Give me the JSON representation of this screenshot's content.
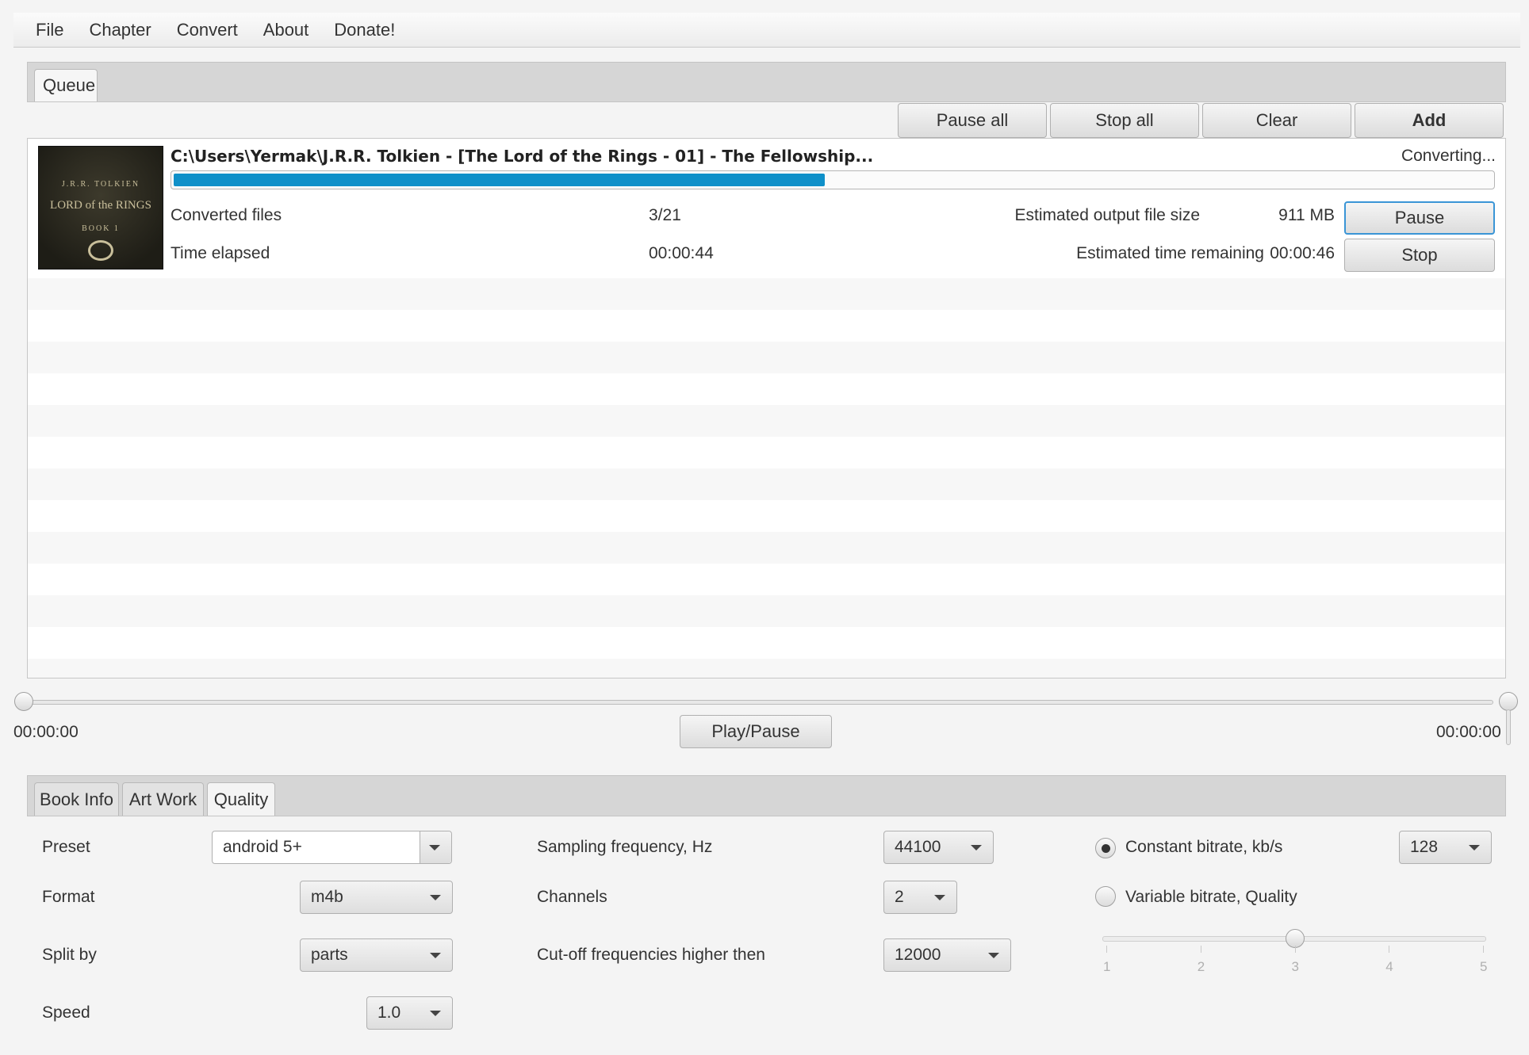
{
  "menu": [
    "File",
    "Chapter",
    "Convert",
    "About",
    "Donate!"
  ],
  "queue": {
    "tab_label": "Queue",
    "toolbar": {
      "pause_all": "Pause all",
      "stop_all": "Stop all",
      "clear": "Clear",
      "add": "Add"
    },
    "item": {
      "title": "C:\\Users\\Yermak\\J.R.R. Tolkien  - [The Lord of the Rings - 01]  - The Fellowship...",
      "status": "Converting...",
      "progress": 0.494,
      "converted_files_label": "Converted files",
      "converted_files_value": "3/21",
      "time_elapsed_label": "Time elapsed",
      "time_elapsed_value": "00:00:44",
      "est_size_label": "Estimated output file size",
      "est_size_value": "911 MB",
      "est_time_label": "Estimated time remaining",
      "est_time_value": "00:00:46",
      "pause": "Pause",
      "stop": "Stop",
      "cover": {
        "author": "J.R.R. TOLKIEN",
        "title": "LORD of the RINGS",
        "book": "BOOK 1"
      }
    }
  },
  "player": {
    "time_start": "00:00:00",
    "time_end": "00:00:00",
    "play_pause": "Play/Pause"
  },
  "bottom_tabs": [
    "Book Info",
    "Art Work",
    "Quality"
  ],
  "quality": {
    "preset_label": "Preset",
    "preset_value": "android 5+",
    "format_label": "Format",
    "format_value": "m4b",
    "split_label": "Split by",
    "split_value": "parts",
    "speed_label": "Speed",
    "speed_value": "1.0",
    "sampling_label": "Sampling frequency, Hz",
    "sampling_value": "44100",
    "channels_label": "Channels",
    "channels_value": "2",
    "cutoff_label": "Cut-off frequencies higher then",
    "cutoff_value": "12000",
    "cbr_label": "Constant bitrate, kb/s",
    "cbr_value": "128",
    "vbr_label": "Variable bitrate, Quality",
    "vbr_quality": 3,
    "vbr_ticks": [
      "1",
      "2",
      "3",
      "4",
      "5"
    ]
  }
}
